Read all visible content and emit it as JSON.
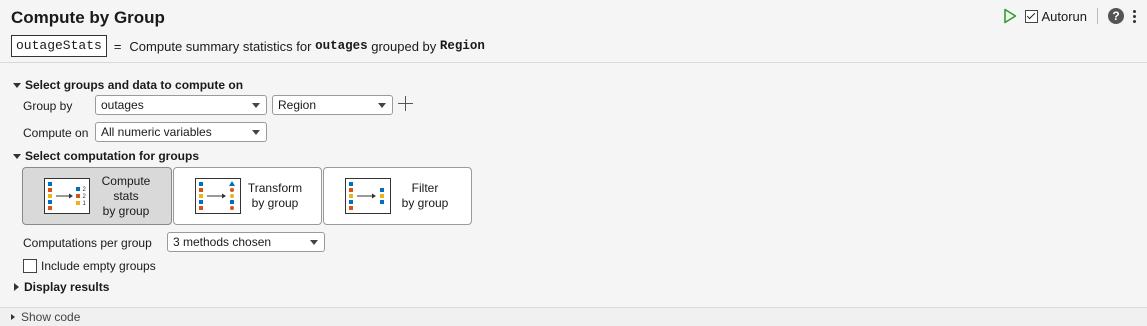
{
  "header": {
    "title": "Compute by Group",
    "output_var": "outageStats",
    "equals": "=",
    "desc_prefix": "Compute summary statistics for",
    "desc_data": "outages",
    "desc_middle": "grouped by",
    "desc_group": "Region",
    "autorun_label": "Autorun",
    "autorun_checked": true,
    "help_label": "?"
  },
  "sections": {
    "select_groups": "Select groups and data to compute on",
    "select_computation": "Select computation for groups",
    "display_results": "Display results"
  },
  "group_by": {
    "label": "Group by",
    "table_value": "outages",
    "variable_value": "Region"
  },
  "compute_on": {
    "label": "Compute on",
    "value": "All numeric variables"
  },
  "tiles": [
    {
      "line1": "Compute",
      "line2": "stats",
      "line3": "by group",
      "selected": true
    },
    {
      "line1": "Transform",
      "line2": "by group",
      "selected": false
    },
    {
      "line1": "Filter",
      "line2": "by group",
      "selected": false
    }
  ],
  "computations": {
    "label": "Computations per group",
    "value": "3 methods chosen"
  },
  "include_empty": {
    "label": "Include empty groups",
    "checked": false
  },
  "footer": {
    "show_code": "Show code"
  },
  "colors": {
    "blue": "#0072bd",
    "orange": "#d95319",
    "yellow": "#edb120",
    "run_green": "#2ca02c"
  }
}
